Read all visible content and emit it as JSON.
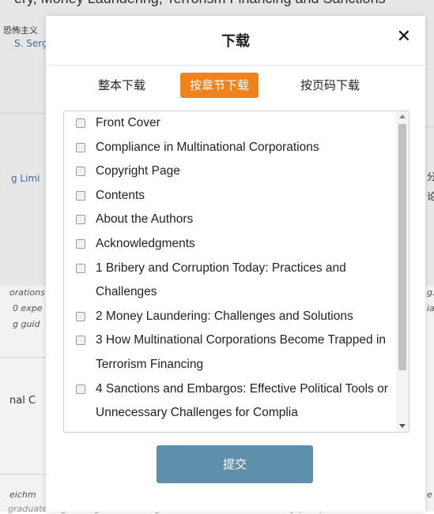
{
  "background": {
    "title": "ery, Money Laundering, Terrorism Financing and Sanctions",
    "author_cn": "恐怖主义",
    "author_link": "S. Serg",
    "publisher_link": "g Limi",
    "right_char1": "分",
    "right_char2": "论",
    "italic_1": "orations",
    "italic_2": "0 expe",
    "italic_3": "g guid",
    "right_italic_1": "g.",
    "right_italic_2": "ia",
    "related_title": "nal C",
    "bottom_1": "eichm",
    "bottom_2": "e",
    "bottom_3": "graduate degree in general management from Harvard University (USA) and in law at univ"
  },
  "modal": {
    "title": "下载",
    "close_label": "✕",
    "tabs": [
      {
        "label": "整本下载",
        "active": false
      },
      {
        "label": "按章节下载",
        "active": true
      },
      {
        "label": "按页码下载",
        "active": false
      }
    ],
    "chapters": [
      "Front Cover",
      "Compliance in Multinational Corporations",
      "Copyright Page",
      "Contents",
      "About the Authors",
      "Acknowledgments",
      "1 Bribery and Corruption Today: Practices and Challenges",
      "2 Money Laundering: Challenges and Solutions",
      "3 How Multinational Corporations Become Trapped in Terrorism Financing",
      "4 Sanctions and Embargos: Effective Political Tools or Unnecessary Challenges for Complia"
    ],
    "submit_label": "提交"
  },
  "colors": {
    "active_tab": "#f0821e",
    "submit_button": "#5e8fab"
  }
}
